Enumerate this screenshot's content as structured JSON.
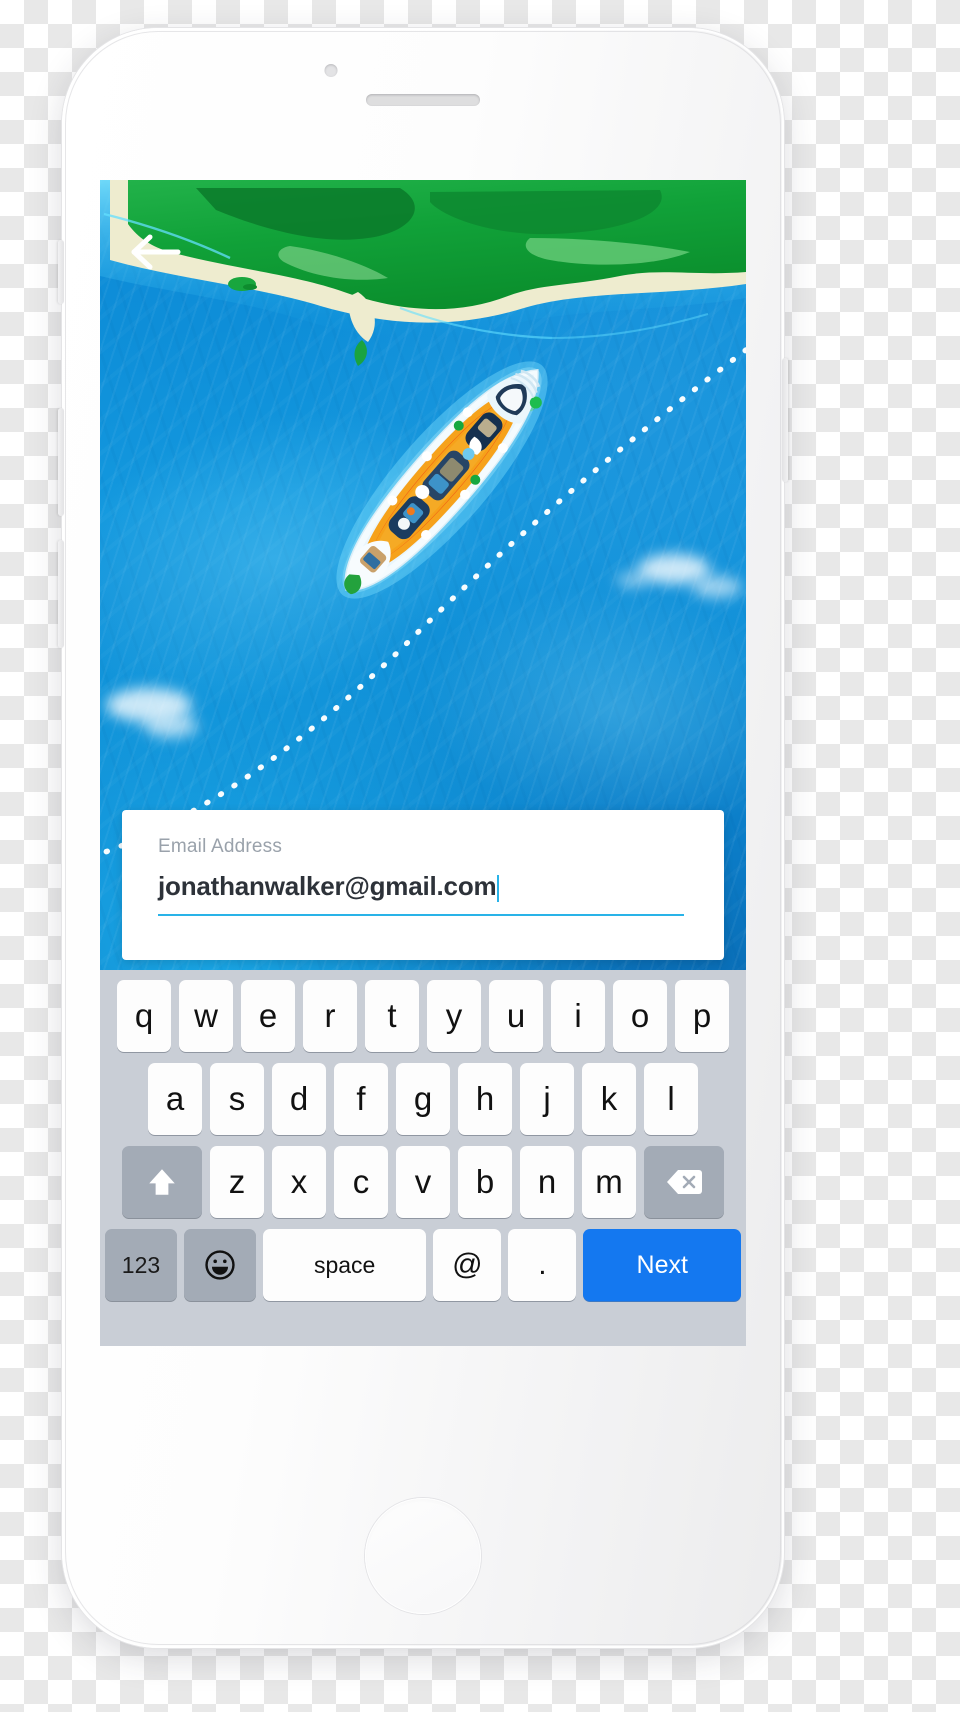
{
  "device": {
    "type": "smartphone-mockup",
    "body_color": "#f7f7f8",
    "hardware": {
      "earpiece": "earpiece-speaker",
      "front_camera": "front-camera",
      "home_button": "home-button",
      "silent_switch": "silent-switch",
      "volume_up": "volume-up-button",
      "volume_down": "volume-down-button",
      "power": "power-button"
    }
  },
  "app": {
    "nav": {
      "back_icon": "arrow-left-icon",
      "back_label": ""
    },
    "hero": {
      "image_name": "aerial-cruise-ship-ocean-photo",
      "subject": "cruise ship",
      "description": "Aerial view of a cruise ship sailing on turquoise ocean past a green tropical island with a dotted route line",
      "ocean_color": "#0f8ed8",
      "ocean_light": "#1aa9e8",
      "island_color": "#12a03c",
      "island_dark": "#0a7a2c",
      "beach_color": "#f2f0da",
      "route_line": "dotted-route-line",
      "route_color": "#ffffff"
    },
    "form": {
      "label": "Email Address",
      "value": "jonathanwalker@gmail.com",
      "placeholder": "Email Address",
      "underline_color": "#29b3e8",
      "caret_color": "#29b3e8",
      "label_color": "#9aa2ab",
      "value_color": "#2d3239",
      "card_background": "#ffffff"
    }
  },
  "keyboard": {
    "layout": "ios-qwerty-email",
    "background": "#c9ced6",
    "key_background": "#fdfdfd",
    "modifier_background": "#a3abb6",
    "accent": "#1478f0",
    "rows": [
      {
        "name": "row-1",
        "keys": [
          {
            "label": "q",
            "name": "key-q"
          },
          {
            "label": "w",
            "name": "key-w"
          },
          {
            "label": "e",
            "name": "key-e"
          },
          {
            "label": "r",
            "name": "key-r"
          },
          {
            "label": "t",
            "name": "key-t"
          },
          {
            "label": "y",
            "name": "key-y"
          },
          {
            "label": "u",
            "name": "key-u"
          },
          {
            "label": "i",
            "name": "key-i"
          },
          {
            "label": "o",
            "name": "key-o"
          },
          {
            "label": "p",
            "name": "key-p"
          }
        ]
      },
      {
        "name": "row-2",
        "keys": [
          {
            "label": "a",
            "name": "key-a"
          },
          {
            "label": "s",
            "name": "key-s"
          },
          {
            "label": "d",
            "name": "key-d"
          },
          {
            "label": "f",
            "name": "key-f"
          },
          {
            "label": "g",
            "name": "key-g"
          },
          {
            "label": "h",
            "name": "key-h"
          },
          {
            "label": "j",
            "name": "key-j"
          },
          {
            "label": "k",
            "name": "key-k"
          },
          {
            "label": "l",
            "name": "key-l"
          }
        ]
      },
      {
        "name": "row-3",
        "keys": [
          {
            "label": "",
            "name": "shift-key",
            "icon": "shift-arrow-up-icon"
          },
          {
            "label": "z",
            "name": "key-z"
          },
          {
            "label": "x",
            "name": "key-x"
          },
          {
            "label": "c",
            "name": "key-c"
          },
          {
            "label": "v",
            "name": "key-v"
          },
          {
            "label": "b",
            "name": "key-b"
          },
          {
            "label": "n",
            "name": "key-n"
          },
          {
            "label": "m",
            "name": "key-m"
          },
          {
            "label": "",
            "name": "backspace-key",
            "icon": "backspace-delete-icon"
          }
        ]
      },
      {
        "name": "row-4",
        "keys": [
          {
            "label": "123",
            "name": "numbers-key"
          },
          {
            "label": "",
            "name": "emoji-key",
            "icon": "smiley-face-icon"
          },
          {
            "label": "space",
            "name": "space-key"
          },
          {
            "label": "@",
            "name": "at-sign-key"
          },
          {
            "label": ".",
            "name": "period-key"
          },
          {
            "label": "Next",
            "name": "next-key"
          }
        ]
      }
    ],
    "labels": {
      "numbers": "123",
      "space": "space",
      "at": "@",
      "period": ".",
      "next": "Next"
    }
  }
}
